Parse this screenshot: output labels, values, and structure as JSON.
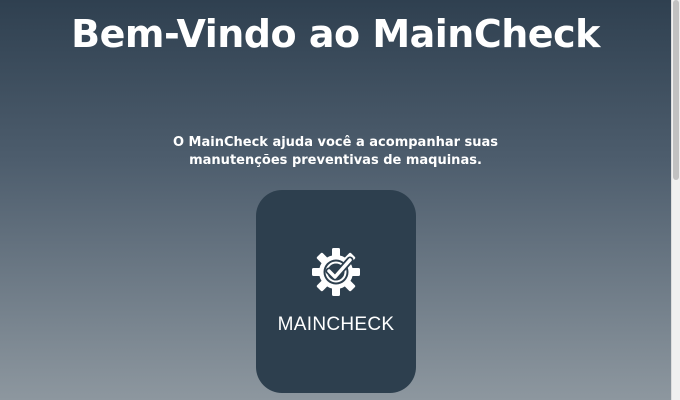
{
  "hero": {
    "title": "Bem-Vindo ao MainCheck",
    "subtitle": "O MainCheck ajuda você a acompanhar suas manutenções preventivas de maquinas."
  },
  "logo": {
    "text": "MAINCHECK",
    "icon": "gear-check-icon",
    "card_color": "#2d3f4e"
  },
  "colors": {
    "background_top": "#2f4050",
    "background_bottom": "#8d979f",
    "text": "#ffffff"
  }
}
